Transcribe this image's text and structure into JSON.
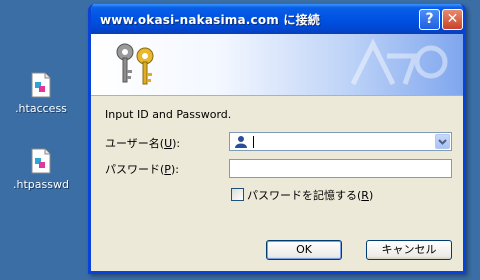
{
  "desktop": {
    "icons": [
      {
        "label": ".htaccess",
        "icon": "document-icon"
      },
      {
        "label": ".htpasswd",
        "icon": "document-icon"
      }
    ]
  },
  "dialog": {
    "title": "www.okasi-nakasima.com に接続",
    "help_glyph": "?",
    "close_glyph": "✕",
    "banner_icon": "keys-icon",
    "prompt": "Input ID and Password.",
    "username": {
      "label_prefix": "ユーザー名(",
      "accel": "U",
      "label_suffix": "):",
      "value": ""
    },
    "password": {
      "label_prefix": "パスワード(",
      "accel": "P",
      "label_suffix": "):",
      "value": ""
    },
    "remember": {
      "label_prefix": "パスワードを記憶する(",
      "accel": "R",
      "label_suffix": ")",
      "checked": false
    },
    "ok_label": "OK",
    "cancel_label": "キャンセル"
  },
  "colors": {
    "desktop": "#3a6ea5",
    "titlebar": "#0054e3",
    "dialog_face": "#ece9d8"
  }
}
